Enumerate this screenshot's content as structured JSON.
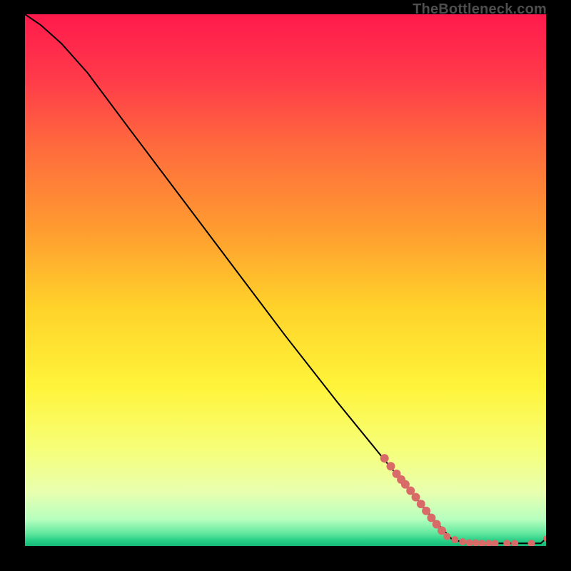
{
  "watermark": "TheBottleneck.com",
  "chart_data": {
    "type": "line",
    "title": "",
    "xlabel": "",
    "ylabel": "",
    "xlim": [
      0,
      100
    ],
    "ylim": [
      0,
      100
    ],
    "grid": false,
    "legend": false,
    "gradient_stops": [
      {
        "pos": 0.0,
        "color": "#ff1a4c"
      },
      {
        "pos": 0.12,
        "color": "#ff3a4a"
      },
      {
        "pos": 0.25,
        "color": "#ff6b3d"
      },
      {
        "pos": 0.4,
        "color": "#ff9a30"
      },
      {
        "pos": 0.55,
        "color": "#ffd22a"
      },
      {
        "pos": 0.7,
        "color": "#fff43a"
      },
      {
        "pos": 0.82,
        "color": "#f6ff7a"
      },
      {
        "pos": 0.9,
        "color": "#e8ffb0"
      },
      {
        "pos": 0.95,
        "color": "#b6ffbf"
      },
      {
        "pos": 0.975,
        "color": "#66e9a0"
      },
      {
        "pos": 0.99,
        "color": "#27cf86"
      },
      {
        "pos": 1.0,
        "color": "#17b877"
      }
    ],
    "curve": [
      {
        "x": 0.0,
        "y": 100.0
      },
      {
        "x": 3.0,
        "y": 98.0
      },
      {
        "x": 7.0,
        "y": 94.5
      },
      {
        "x": 12.0,
        "y": 89.0
      },
      {
        "x": 20.0,
        "y": 78.5
      },
      {
        "x": 30.0,
        "y": 65.5
      },
      {
        "x": 40.0,
        "y": 52.5
      },
      {
        "x": 50.0,
        "y": 39.5
      },
      {
        "x": 60.0,
        "y": 27.0
      },
      {
        "x": 70.0,
        "y": 15.0
      },
      {
        "x": 78.0,
        "y": 5.5
      },
      {
        "x": 82.0,
        "y": 1.2
      },
      {
        "x": 85.0,
        "y": 0.6
      },
      {
        "x": 90.0,
        "y": 0.5
      },
      {
        "x": 95.0,
        "y": 0.5
      },
      {
        "x": 99.0,
        "y": 0.5
      },
      {
        "x": 100.0,
        "y": 1.4
      }
    ],
    "markers": [
      {
        "x": 69.0,
        "y": 16.5,
        "r": 6
      },
      {
        "x": 70.2,
        "y": 15.0,
        "r": 6
      },
      {
        "x": 71.3,
        "y": 13.6,
        "r": 6
      },
      {
        "x": 72.2,
        "y": 12.5,
        "r": 6
      },
      {
        "x": 73.0,
        "y": 11.6,
        "r": 6
      },
      {
        "x": 74.0,
        "y": 10.4,
        "r": 6
      },
      {
        "x": 75.0,
        "y": 9.2,
        "r": 6
      },
      {
        "x": 76.0,
        "y": 7.9,
        "r": 6
      },
      {
        "x": 77.0,
        "y": 6.6,
        "r": 6
      },
      {
        "x": 78.0,
        "y": 5.3,
        "r": 6
      },
      {
        "x": 79.0,
        "y": 4.1,
        "r": 6
      },
      {
        "x": 80.0,
        "y": 2.9,
        "r": 6
      },
      {
        "x": 81.0,
        "y": 1.8,
        "r": 5
      },
      {
        "x": 82.5,
        "y": 1.2,
        "r": 5
      },
      {
        "x": 84.0,
        "y": 0.8,
        "r": 5
      },
      {
        "x": 85.3,
        "y": 0.6,
        "r": 5
      },
      {
        "x": 86.5,
        "y": 0.6,
        "r": 5
      },
      {
        "x": 87.7,
        "y": 0.5,
        "r": 5
      },
      {
        "x": 89.0,
        "y": 0.5,
        "r": 5
      },
      {
        "x": 90.2,
        "y": 0.5,
        "r": 5
      },
      {
        "x": 92.5,
        "y": 0.5,
        "r": 5
      },
      {
        "x": 94.0,
        "y": 0.5,
        "r": 5
      },
      {
        "x": 97.2,
        "y": 0.5,
        "r": 5
      },
      {
        "x": 100.0,
        "y": 1.4,
        "r": 4
      }
    ],
    "marker_color": "#d86b68",
    "line_color": "#000000"
  }
}
